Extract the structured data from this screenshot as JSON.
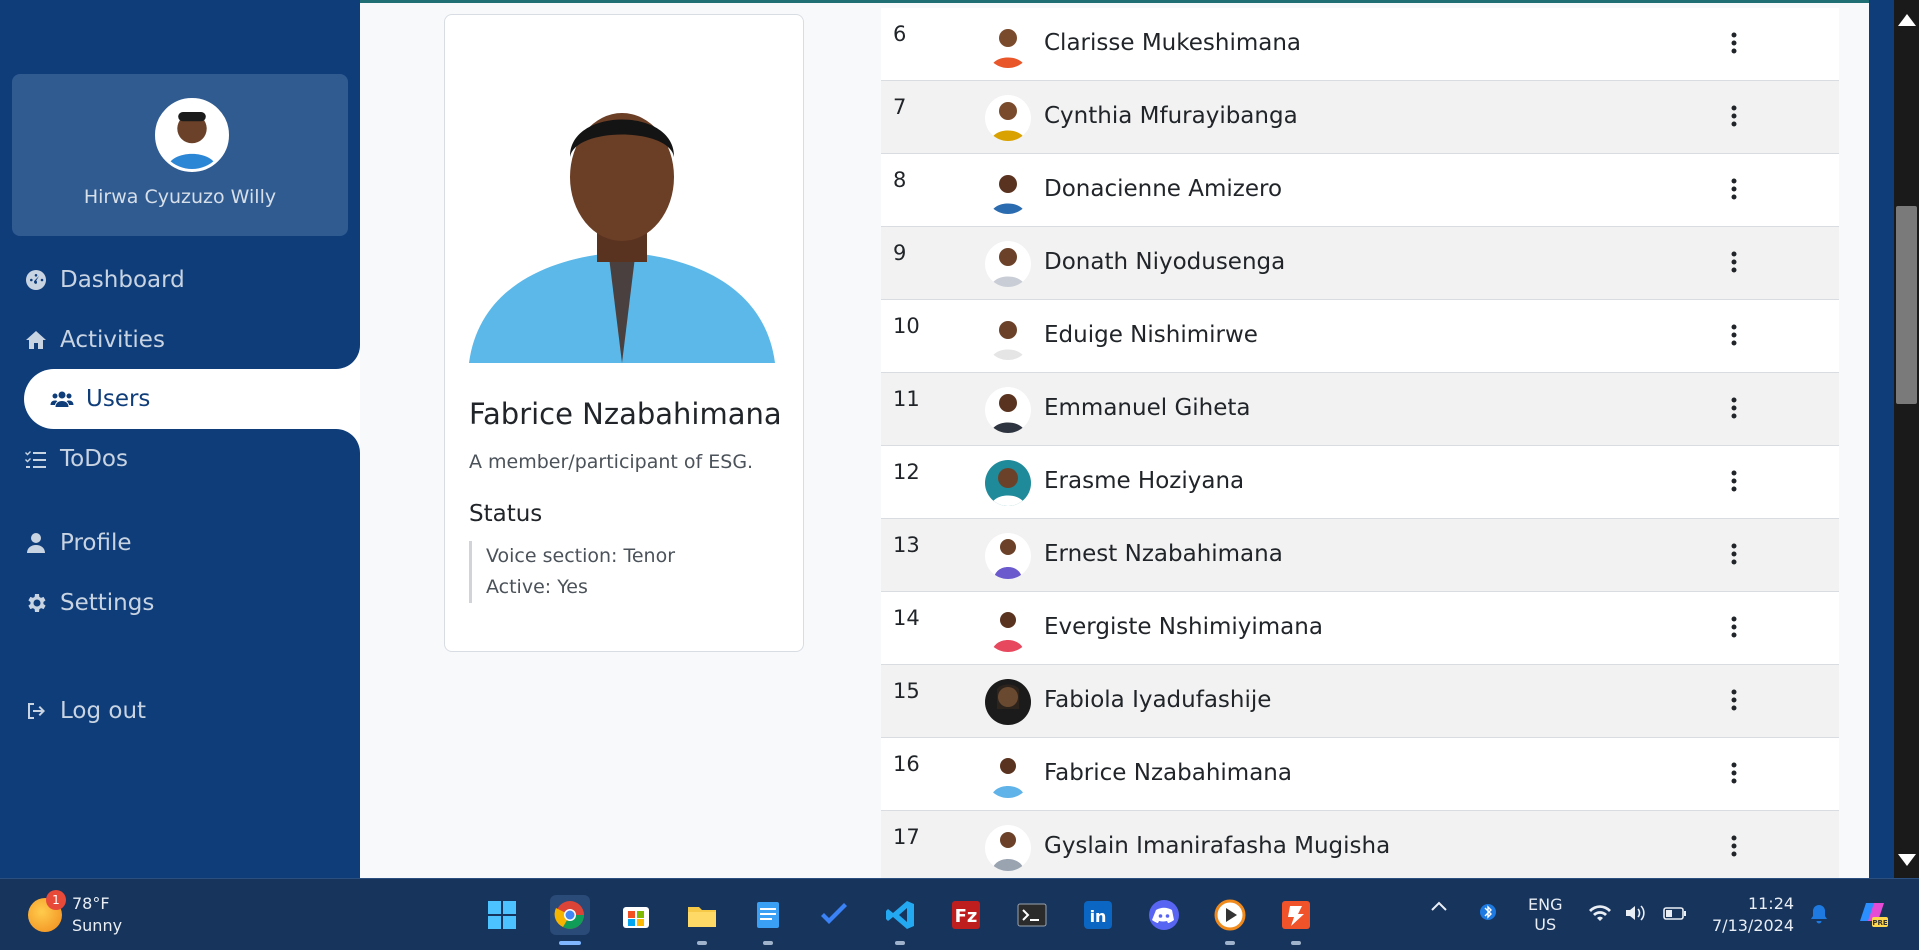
{
  "sidebar": {
    "user_name": "Hirwa Cyuzuzo Willy",
    "items": [
      {
        "label": "Dashboard",
        "icon": "dashboard-gauge-icon"
      },
      {
        "label": "Activities",
        "icon": "home-icon"
      },
      {
        "label": "Users",
        "icon": "users-icon",
        "active": true
      },
      {
        "label": "ToDos",
        "icon": "list-check-icon"
      },
      {
        "label": "Profile",
        "icon": "user-icon"
      },
      {
        "label": "Settings",
        "icon": "gear-icon"
      },
      {
        "label": "Log out",
        "icon": "logout-icon"
      }
    ]
  },
  "profile": {
    "name": "Fabrice Nzabahimana",
    "description": "A member/participant of ESG.",
    "status_heading": "Status",
    "voice": "Voice section: Tenor",
    "active": "Active: Yes"
  },
  "users": [
    {
      "num": "6",
      "name": "Clarisse Mukeshimana",
      "color": "#e8562a"
    },
    {
      "num": "7",
      "name": "Cynthia Mfurayibanga",
      "color": "#d9a200"
    },
    {
      "num": "8",
      "name": "Donacienne Amizero",
      "color": "#2b6cb0"
    },
    {
      "num": "9",
      "name": "Donath Niyodusenga",
      "color": "#c9ced6"
    },
    {
      "num": "10",
      "name": "Eduige Nishimirwe",
      "color": "#e5e5e5"
    },
    {
      "num": "11",
      "name": "Emmanuel Giheta",
      "color": "#2f3540"
    },
    {
      "num": "12",
      "name": "Erasme Hoziyana",
      "color": "#1f8a9a"
    },
    {
      "num": "13",
      "name": "Ernest Nzabahimana",
      "color": "#6a5acd"
    },
    {
      "num": "14",
      "name": "Evergiste Nshimiyimana",
      "color": "#e8485e"
    },
    {
      "num": "15",
      "name": "Fabiola Iyadufashije",
      "color": "#1b1b1b"
    },
    {
      "num": "16",
      "name": "Fabrice Nzabahimana",
      "color": "#5fb3e8"
    },
    {
      "num": "17",
      "name": "Gyslain Imanirafasha Mugisha",
      "color": "#9aa4b1"
    }
  ],
  "taskbar": {
    "weather_badge": "1",
    "temperature": "78°F",
    "condition": "Sunny",
    "language_top": "ENG",
    "language_bottom": "US",
    "time": "11:24",
    "date": "7/13/2024",
    "apps": [
      "windows-start-icon",
      "chrome-icon",
      "microsoft-store-icon",
      "file-explorer-icon",
      "notepad-icon",
      "todo-icon",
      "vscode-icon",
      "filezilla-icon",
      "terminal-icon",
      "linkedin-icon",
      "discord-icon",
      "media-player-icon",
      "reader-icon"
    ]
  }
}
